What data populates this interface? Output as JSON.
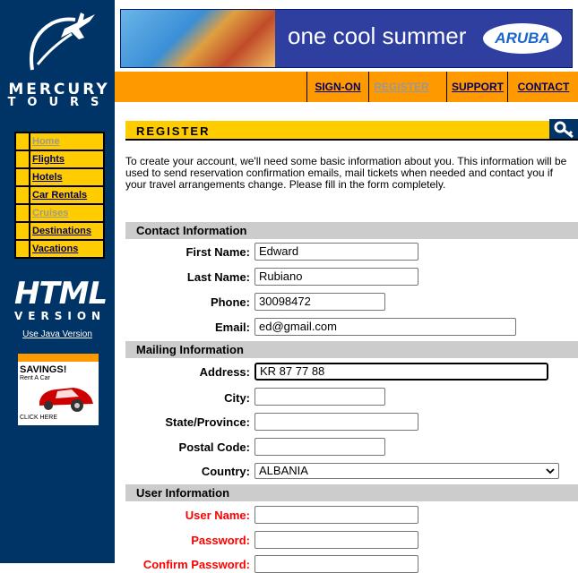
{
  "brand": {
    "name_line1": "MERCURY",
    "name_line2": "TOURS"
  },
  "sidebar": {
    "menu": [
      {
        "label": "Home",
        "dim": true
      },
      {
        "label": "Flights",
        "dim": false
      },
      {
        "label": "Hotels",
        "dim": false
      },
      {
        "label": "Car Rentals",
        "dim": false
      },
      {
        "label": "Cruises",
        "dim": true
      },
      {
        "label": "Destinations",
        "dim": false
      },
      {
        "label": "Vacations",
        "dim": false
      }
    ],
    "badge_html": "HTML",
    "badge_version": "VERSION",
    "java_link": "Use Java Version",
    "ad": {
      "title": "SAVINGS!",
      "subtitle": "Rent A Car",
      "cta": "CLICK HERE"
    }
  },
  "banner": {
    "text": "one cool summer",
    "logo": "ARUBA"
  },
  "nav": {
    "signon": "SIGN-ON",
    "register": "REGISTER",
    "support": "SUPPORT",
    "contact": "CONTACT"
  },
  "page": {
    "title": "REGISTER",
    "intro": "To create your account, we'll need some basic information about you. This information will be used to send reservation confirmation emails, mail tickets when needed and contact you if your travel arrangements change. Please fill in the form completely."
  },
  "sections": {
    "contact": "Contact Information",
    "mailing": "Mailing Information",
    "user": "User Information"
  },
  "labels": {
    "first_name": "First Name:",
    "last_name": "Last Name:",
    "phone": "Phone:",
    "email": "Email:",
    "address": "Address:",
    "city": "City:",
    "state": "State/Province:",
    "postal": "Postal Code:",
    "country": "Country:",
    "username": "User Name:",
    "password": "Password:",
    "confirm": "Confirm Password:"
  },
  "values": {
    "first_name": "Edward",
    "last_name": "Rubiano",
    "phone": "30098472",
    "email": "ed@gmail.com",
    "address": "KR 87 77 88",
    "city": "",
    "state": "",
    "postal": "",
    "country": "ALBANIA",
    "username": "",
    "password": "",
    "confirm": ""
  },
  "colors": {
    "sidebar": "#003366",
    "accent": "#ffcc00",
    "nav": "#ff9900",
    "required": "#ff0000"
  },
  "icons": {
    "logo": "plane-logo-icon",
    "key": "key-icon",
    "chevron": "chevron-down-icon"
  }
}
